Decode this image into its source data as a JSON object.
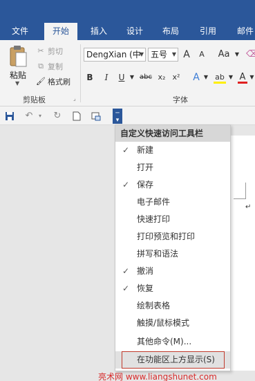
{
  "tabs": [
    {
      "label": "文件"
    },
    {
      "label": "开始"
    },
    {
      "label": "插入"
    },
    {
      "label": "设计"
    },
    {
      "label": "布局"
    },
    {
      "label": "引用"
    },
    {
      "label": "邮件"
    }
  ],
  "clipboard": {
    "paste": "粘贴",
    "cut": "剪切",
    "copy": "复制",
    "format_painter": "格式刷",
    "group_label": "剪贴板"
  },
  "font": {
    "name": "DengXian (中",
    "size": "五号",
    "grow": "A",
    "shrink": "A",
    "case": "Aa",
    "bold": "B",
    "italic": "I",
    "underline": "U",
    "strike": "abc",
    "subscript": "x₂",
    "superscript": "x²",
    "text_effect": "A",
    "highlight": "ab",
    "font_color": "A",
    "group_label": "字体"
  },
  "menu": {
    "title": "自定义快速访问工具栏",
    "items": [
      {
        "label": "新建",
        "checked": "✓"
      },
      {
        "label": "打开",
        "checked": ""
      },
      {
        "label": "保存",
        "checked": "✓"
      },
      {
        "label": "电子邮件",
        "checked": ""
      },
      {
        "label": "快速打印",
        "checked": ""
      },
      {
        "label": "打印预览和打印",
        "checked": ""
      },
      {
        "label": "拼写和语法",
        "checked": ""
      },
      {
        "label": "撤消",
        "checked": "✓"
      },
      {
        "label": "恢复",
        "checked": "✓"
      },
      {
        "label": "绘制表格",
        "checked": ""
      },
      {
        "label": "触摸/鼠标模式",
        "checked": ""
      },
      {
        "label": "其他命令(M)...",
        "checked": ""
      },
      {
        "label": "在功能区上方显示(S)",
        "checked": ""
      }
    ]
  },
  "watermark": "亮术网 www.liangshunet.com",
  "colors": {
    "brand": "#2b579a",
    "highlight_red": "#c0392b",
    "watermark": "#d62b2b"
  }
}
